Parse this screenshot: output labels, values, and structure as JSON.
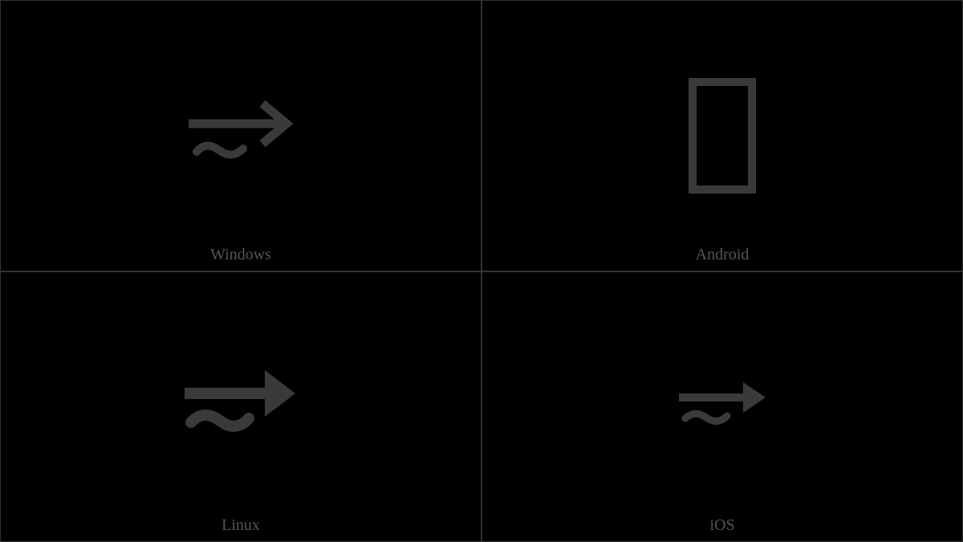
{
  "cells": [
    {
      "label": "Windows",
      "glyph": "arrow-tilde-windows"
    },
    {
      "label": "Android",
      "glyph": "missing-glyph"
    },
    {
      "label": "Linux",
      "glyph": "arrow-tilde-linux"
    },
    {
      "label": "iOS",
      "glyph": "arrow-tilde-ios"
    }
  ],
  "glyph_color": "#3a3a3a"
}
